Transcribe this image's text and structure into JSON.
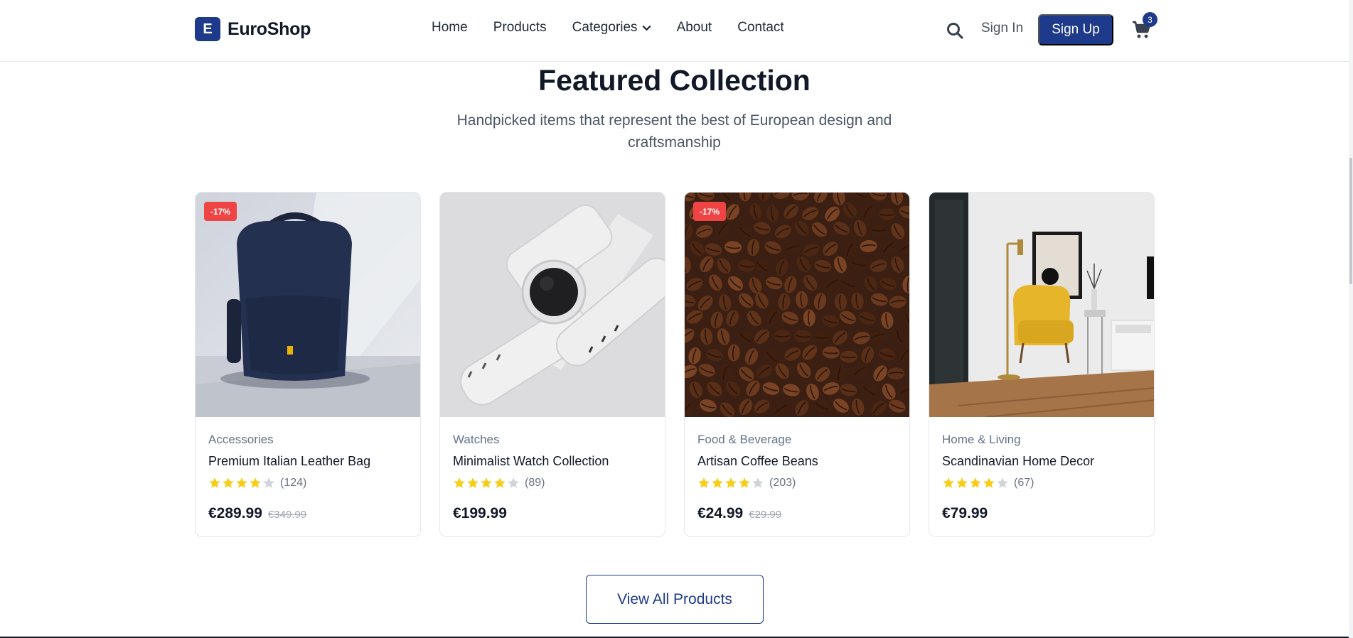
{
  "brand": {
    "logo_letter": "E",
    "name": "EuroShop",
    "colors": {
      "primary": "#1e3a8a",
      "discount": "#ef4444",
      "star": "#facc15"
    }
  },
  "nav": {
    "items": [
      "Home",
      "Products",
      "Categories",
      "About",
      "Contact"
    ],
    "categories_icon": "chevron-down-icon"
  },
  "header_actions": {
    "search_icon": "search-icon",
    "sign_in": "Sign In",
    "sign_up": "Sign Up",
    "cart_icon": "shopping-cart-icon",
    "cart_count": "3"
  },
  "featured": {
    "title": "Featured Collection",
    "subtitle": "Handpicked items that represent the best of European design and craftsmanship",
    "view_all": "View All Products",
    "products": [
      {
        "badge": "-17%",
        "category": "Accessories",
        "name": "Premium Italian Leather Bag",
        "rating": 4,
        "reviews": "(124)",
        "price": "€289.99",
        "old_price": "€349.99",
        "image": "navy-backpack"
      },
      {
        "badge": "",
        "category": "Watches",
        "name": "Minimalist Watch Collection",
        "rating": 4,
        "reviews": "(89)",
        "price": "€199.99",
        "old_price": "",
        "image": "white-smartwatch"
      },
      {
        "badge": "-17%",
        "category": "Food & Beverage",
        "name": "Artisan Coffee Beans",
        "rating": 4,
        "reviews": "(203)",
        "price": "€24.99",
        "old_price": "€29.99",
        "image": "coffee-beans"
      },
      {
        "badge": "",
        "category": "Home & Living",
        "name": "Scandinavian Home Decor",
        "rating": 4,
        "reviews": "(67)",
        "price": "€79.99",
        "old_price": "",
        "image": "yellow-armchair-room"
      }
    ]
  }
}
